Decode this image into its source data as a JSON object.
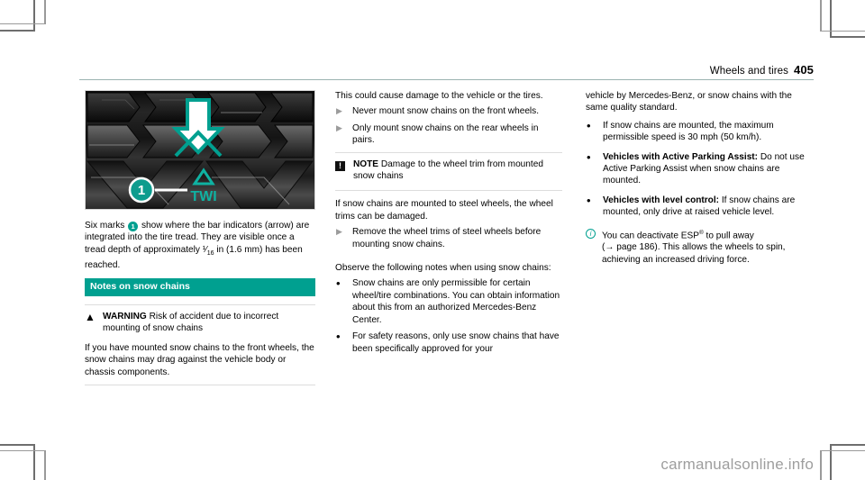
{
  "header": {
    "title": "Wheels and tires",
    "page_number": "405"
  },
  "figure": {
    "caption_marker": "1",
    "twi_label": "TWI",
    "arrow_icon": "down-arrow-icon"
  },
  "left_column": {
    "intro": {
      "before_marker": "Six marks",
      "marker": "1",
      "after_marker": "show where the bar indicators (arrow) are integrated into the tire tread. They are visible once a tread depth of approximately"
    },
    "fraction": "1/16",
    "intro_end": "in (1.6 mm) has been reached.",
    "section_heading": "Notes on snow chains",
    "warning": {
      "icon": "warning-triangle-icon",
      "label": "WARNING",
      "title": "Risk of accident due to incorrect mounting of snow chains",
      "body": "If you have mounted snow chains to the front wheels, the snow chains may drag against the vehicle body or chassis components."
    }
  },
  "middle_column": {
    "continued_text": "This could cause damage to the vehicle or the tires.",
    "actions": [
      "Never mount snow chains on the front wheels.",
      "Only mount snow chains on the rear wheels in pairs."
    ],
    "note": {
      "icon": "note-exclamation-icon",
      "label": "NOTE",
      "title": "Damage to the wheel trim from mounted snow chains",
      "body": "If snow chains are mounted to steel wheels, the wheel trims can be damaged.",
      "actions": [
        "Remove the wheel trims of steel wheels before mounting snow chains."
      ]
    },
    "observe_lead": "Observe the following notes when using snow chains:",
    "bullets": [
      "Snow chains are only permissible for certain wheel/tire combinations. You can obtain information about this from an authorized Mercedes-Benz Center.",
      "For safety reasons, only use snow chains that have been specifically approved for your"
    ]
  },
  "right_column": {
    "continued_text": "vehicle by Mercedes-Benz, or snow chains with the same quality standard.",
    "bullets": [
      {
        "bold": "",
        "text": "If snow chains are mounted, the maximum permissible speed is 30 mph (50 km/h)."
      },
      {
        "bold": "Vehicles with Active Parking Assist:",
        "text": "Do not use Active Parking Assist when snow chains are mounted."
      },
      {
        "bold": "Vehicles with level control:",
        "text": "If snow chains are mounted, only drive at raised vehicle level."
      }
    ],
    "info": {
      "icon": "info-circle-icon",
      "line1_a": "You can deactivate ESP",
      "line1_sup": "®",
      "line1_b": " to pull away",
      "line2": "(→ page 186). This allows the wheels to spin, achieving an increased driving force."
    }
  },
  "watermark": "carmanualsonline.info",
  "colors": {
    "accent_teal": "#00a090",
    "rule": "#9bb3b1",
    "box_border": "#dddddd",
    "bullet_gray": "#9c9c9c",
    "watermark_gray": "#9e9e9e"
  }
}
